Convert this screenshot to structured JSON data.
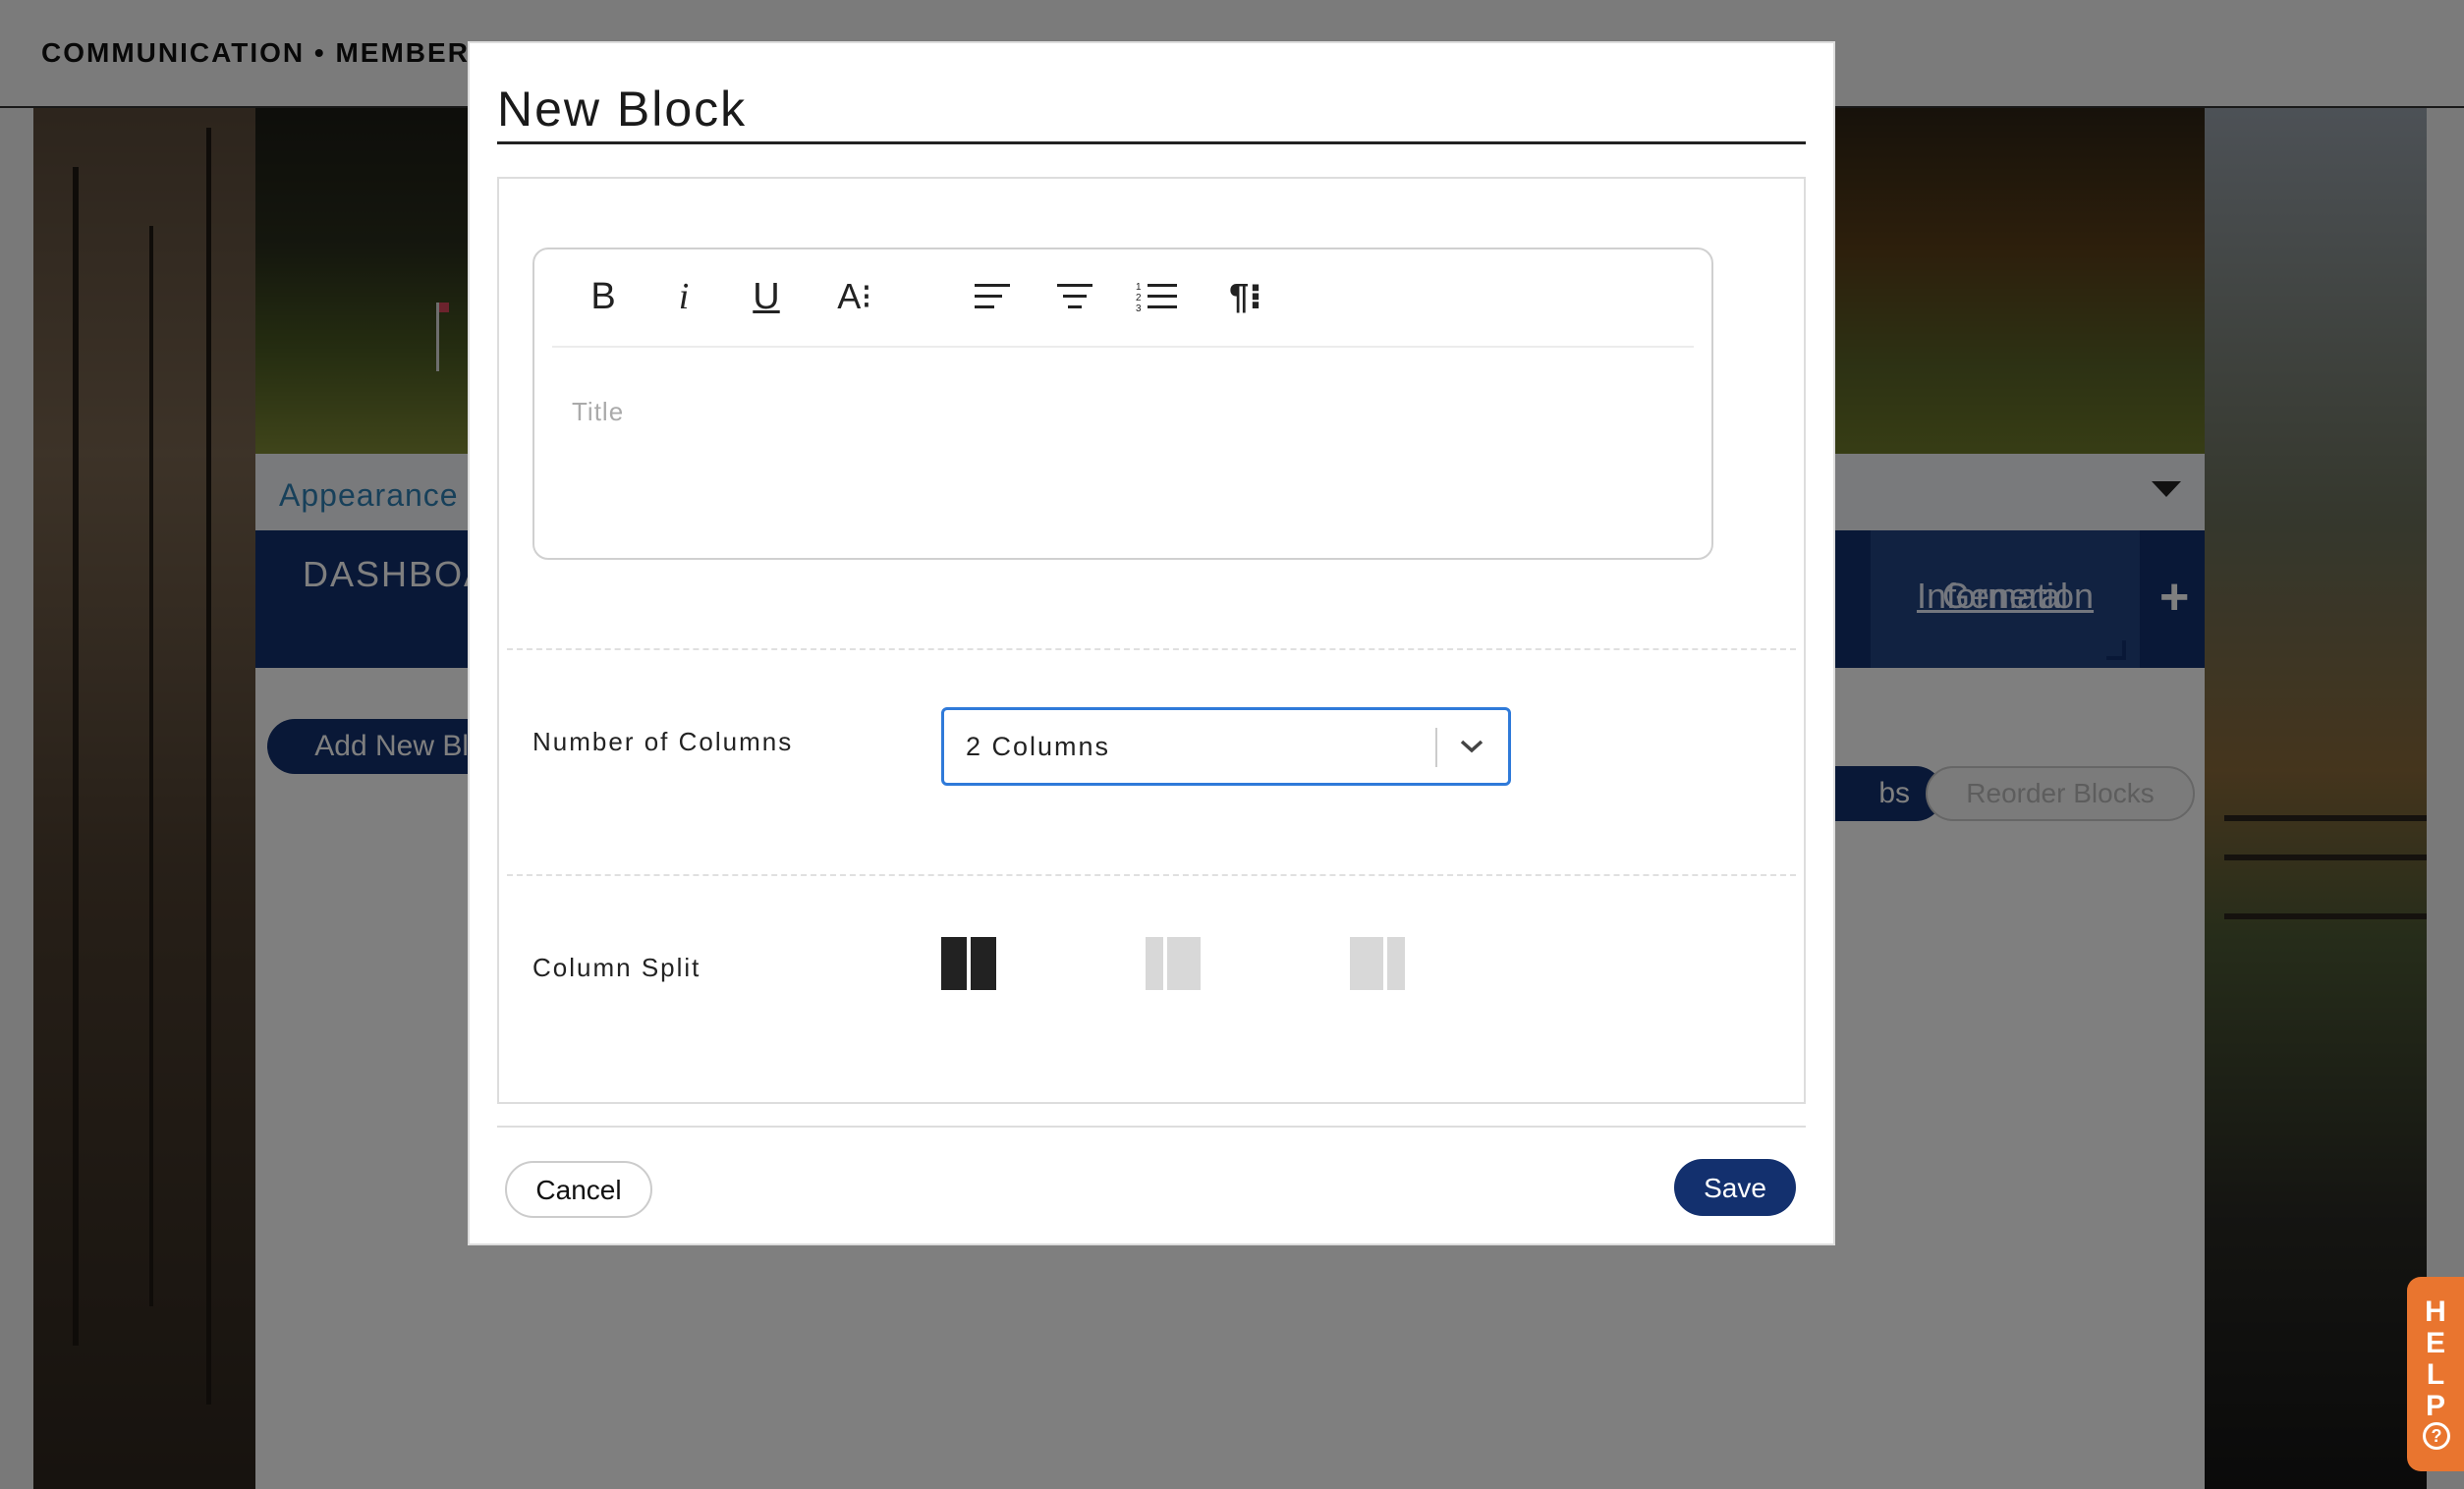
{
  "breadcrumb": "COMMUNICATION • MEMBER",
  "appearance": {
    "label": "Appearance"
  },
  "nav_tabs": {
    "dashboard": "DASHBOA",
    "general_line1": "General",
    "general_line2": "Information",
    "add_symbol": "+"
  },
  "content": {
    "add_block_label": "Add New Block",
    "tabs_btn_label": "bs",
    "reorder_label": "Reorder Blocks"
  },
  "help": {
    "letters": [
      "H",
      "E",
      "L",
      "P"
    ],
    "question": "?"
  },
  "modal": {
    "title": "New Block",
    "editor": {
      "toolbar": [
        {
          "name": "bold-button",
          "glyph": "B"
        },
        {
          "name": "italic-button",
          "glyph": "i"
        },
        {
          "name": "underline-button",
          "glyph": "U"
        },
        {
          "name": "font-size-button",
          "glyph": "A⁝"
        },
        {
          "name": "align-left-icon"
        },
        {
          "name": "align-center-icon"
        },
        {
          "name": "ordered-list-icon"
        },
        {
          "name": "paragraph-format-button",
          "glyph": "¶⁝"
        }
      ],
      "title_placeholder": "Title"
    },
    "columns": {
      "label": "Number of Columns",
      "selected": "2 Columns"
    },
    "split": {
      "label": "Column Split",
      "options": [
        "50/50",
        "33/67",
        "67/33"
      ],
      "selected_index": 0
    },
    "cancel_label": "Cancel",
    "save_label": "Save"
  },
  "colors": {
    "navy": "#13306e",
    "select_border": "#2f7ad9",
    "help_orange": "#e9752f",
    "link_blue": "#2f80b5"
  }
}
